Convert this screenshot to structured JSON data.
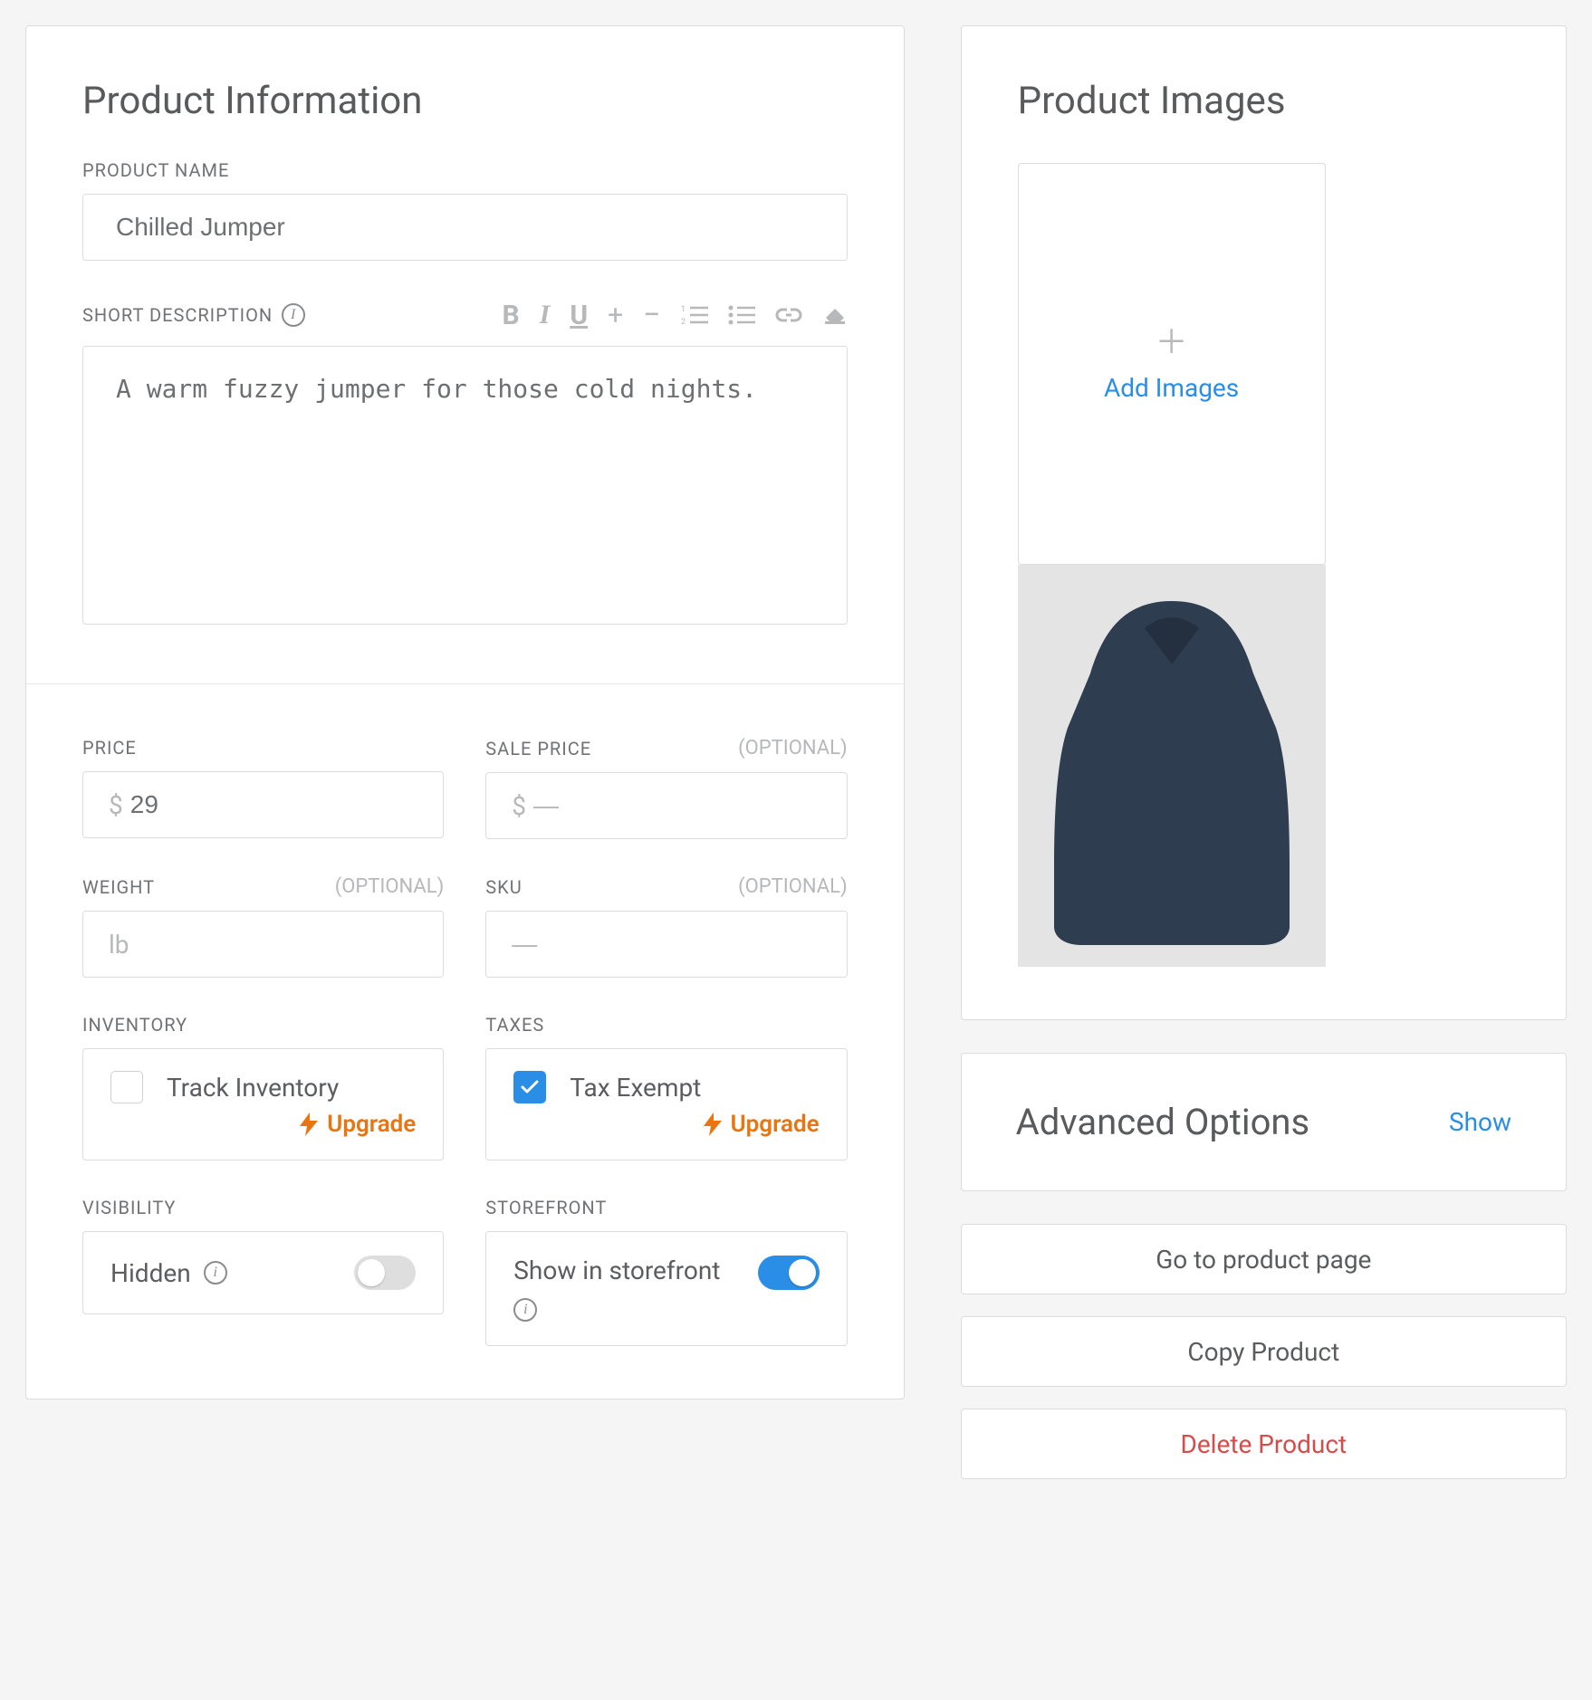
{
  "productInfo": {
    "title": "Product Information",
    "nameLabel": "PRODUCT NAME",
    "nameValue": "Chilled Jumper",
    "shortDescLabel": "SHORT DESCRIPTION",
    "shortDescValue": "A warm fuzzy jumper for those cold nights."
  },
  "pricing": {
    "priceLabel": "PRICE",
    "priceCurrency": "$",
    "priceValue": "29",
    "salePriceLabel": "SALE PRICE",
    "salePriceCurrency": "$",
    "salePricePlaceholder": "—",
    "optional": "(OPTIONAL)",
    "weightLabel": "WEIGHT",
    "weightUnit": "lb",
    "skuLabel": "SKU",
    "skuPlaceholder": "—",
    "inventoryLabel": "INVENTORY",
    "trackInventory": "Track Inventory",
    "upgrade": "Upgrade",
    "taxesLabel": "TAXES",
    "taxExempt": "Tax Exempt",
    "visibilityLabel": "VISIBILITY",
    "hidden": "Hidden",
    "storefrontLabel": "STOREFRONT",
    "showInStorefront": "Show in storefront"
  },
  "images": {
    "title": "Product Images",
    "addImages": "Add Images"
  },
  "advanced": {
    "title": "Advanced Options",
    "show": "Show"
  },
  "actions": {
    "goToProduct": "Go to product page",
    "copy": "Copy Product",
    "delete": "Delete Product"
  }
}
